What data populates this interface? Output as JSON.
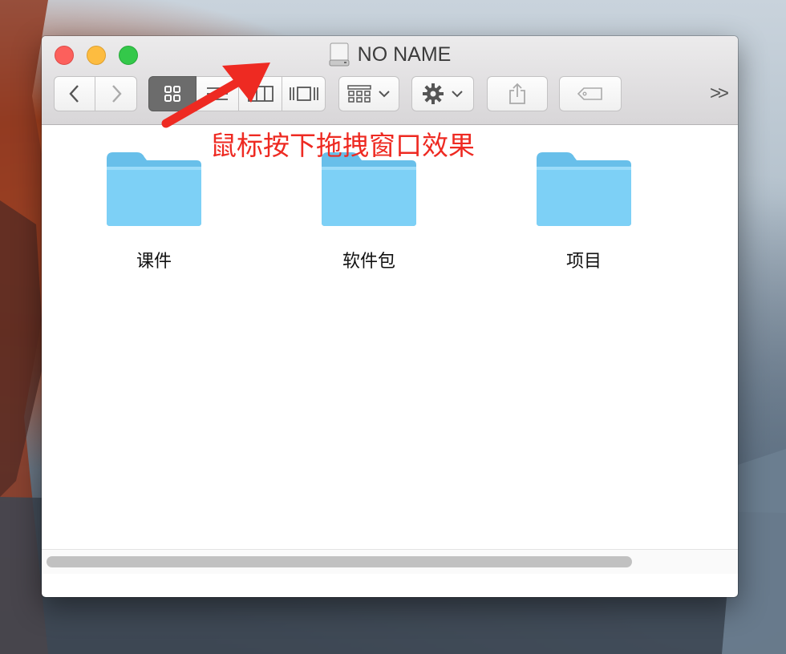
{
  "window": {
    "title": "NO NAME",
    "title_icon": "drive-icon"
  },
  "toolbar": {
    "back_icon": "chevron-left-icon",
    "forward_icon": "chevron-right-icon",
    "view_modes": [
      {
        "name": "icon-view",
        "icon": "grid-icon",
        "active": true
      },
      {
        "name": "list-view",
        "icon": "list-icon",
        "active": false
      },
      {
        "name": "column-view",
        "icon": "columns-icon",
        "active": false
      },
      {
        "name": "cover-flow-view",
        "icon": "coverflow-icon",
        "active": false
      }
    ],
    "arrange_icon": "arrange-icon",
    "action_icon": "gear-icon",
    "share_icon": "share-icon",
    "tags_icon": "tag-icon",
    "overflow_label": ">>"
  },
  "items": [
    {
      "label": "课件",
      "icon": "folder-icon"
    },
    {
      "label": "软件包",
      "icon": "folder-icon"
    },
    {
      "label": "项目",
      "icon": "folder-icon"
    }
  ],
  "annotation": {
    "text": "鼠标按下拖拽窗口效果",
    "color": "#ee2a22"
  },
  "colors": {
    "folder": "#7dd0f6",
    "close": "#fc605c",
    "minimize": "#fdbc40",
    "maximize": "#34c84a"
  }
}
